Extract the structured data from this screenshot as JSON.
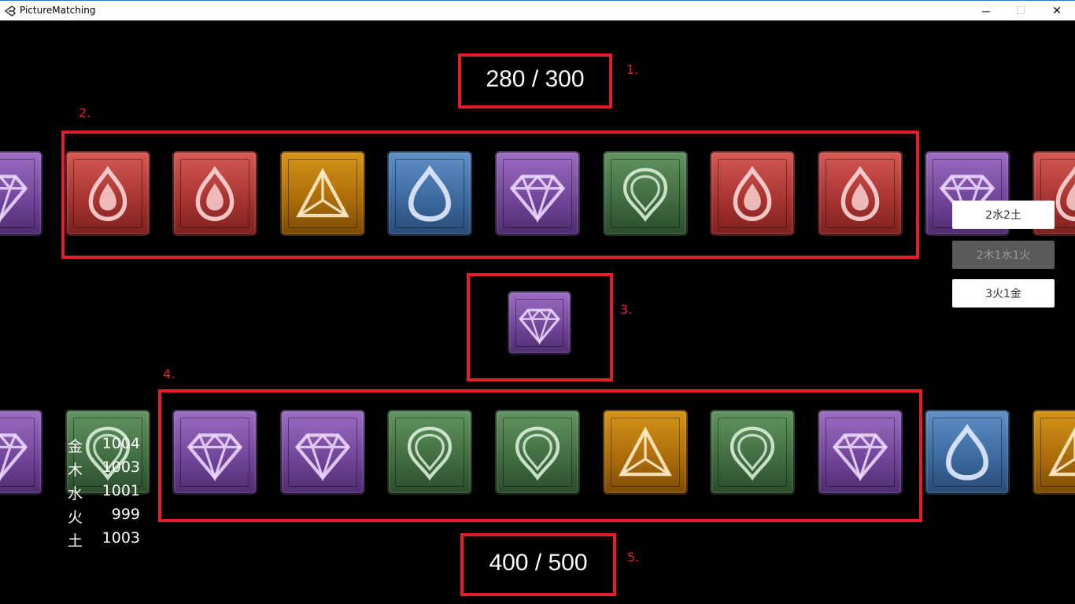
{
  "window": {
    "title": "PictureMatching",
    "minimize_glyph": "─",
    "maximize_glyph": "☐",
    "close_glyph": "✕"
  },
  "counters": {
    "top": "280 / 300",
    "bottom": "400 / 500"
  },
  "markers": [
    "1.",
    "2.",
    "3.",
    "4.",
    "5."
  ],
  "top_row": [
    "purple",
    "red",
    "red",
    "gold",
    "blue",
    "purple",
    "green",
    "red",
    "red",
    "purple",
    "red"
  ],
  "current_tile": "purple",
  "bottom_row": [
    "purple",
    "green",
    "purple",
    "purple",
    "green",
    "green",
    "gold",
    "green",
    "purple",
    "blue",
    "gold"
  ],
  "element_icons": {
    "red": "fire-drop-icon",
    "purple": "gem-icon",
    "gold": "pyramid-icon",
    "blue": "water-drop-icon",
    "green": "leaf-icon"
  },
  "side_buttons": [
    {
      "label": "2水2土",
      "enabled": true
    },
    {
      "label": "2木1水1火",
      "enabled": false
    },
    {
      "label": "3火1金",
      "enabled": true
    }
  ],
  "stats": [
    {
      "key": "金",
      "value": "1004"
    },
    {
      "key": "木",
      "value": "1003"
    },
    {
      "key": "水",
      "value": "1001"
    },
    {
      "key": "火",
      "value": "999"
    },
    {
      "key": "土",
      "value": "1003"
    }
  ],
  "colors": {
    "highlight": "#e3202a",
    "red": "#a4322f",
    "purple": "#6f4396",
    "gold": "#a96a09",
    "blue": "#3b679c",
    "green": "#3f6a3f"
  }
}
